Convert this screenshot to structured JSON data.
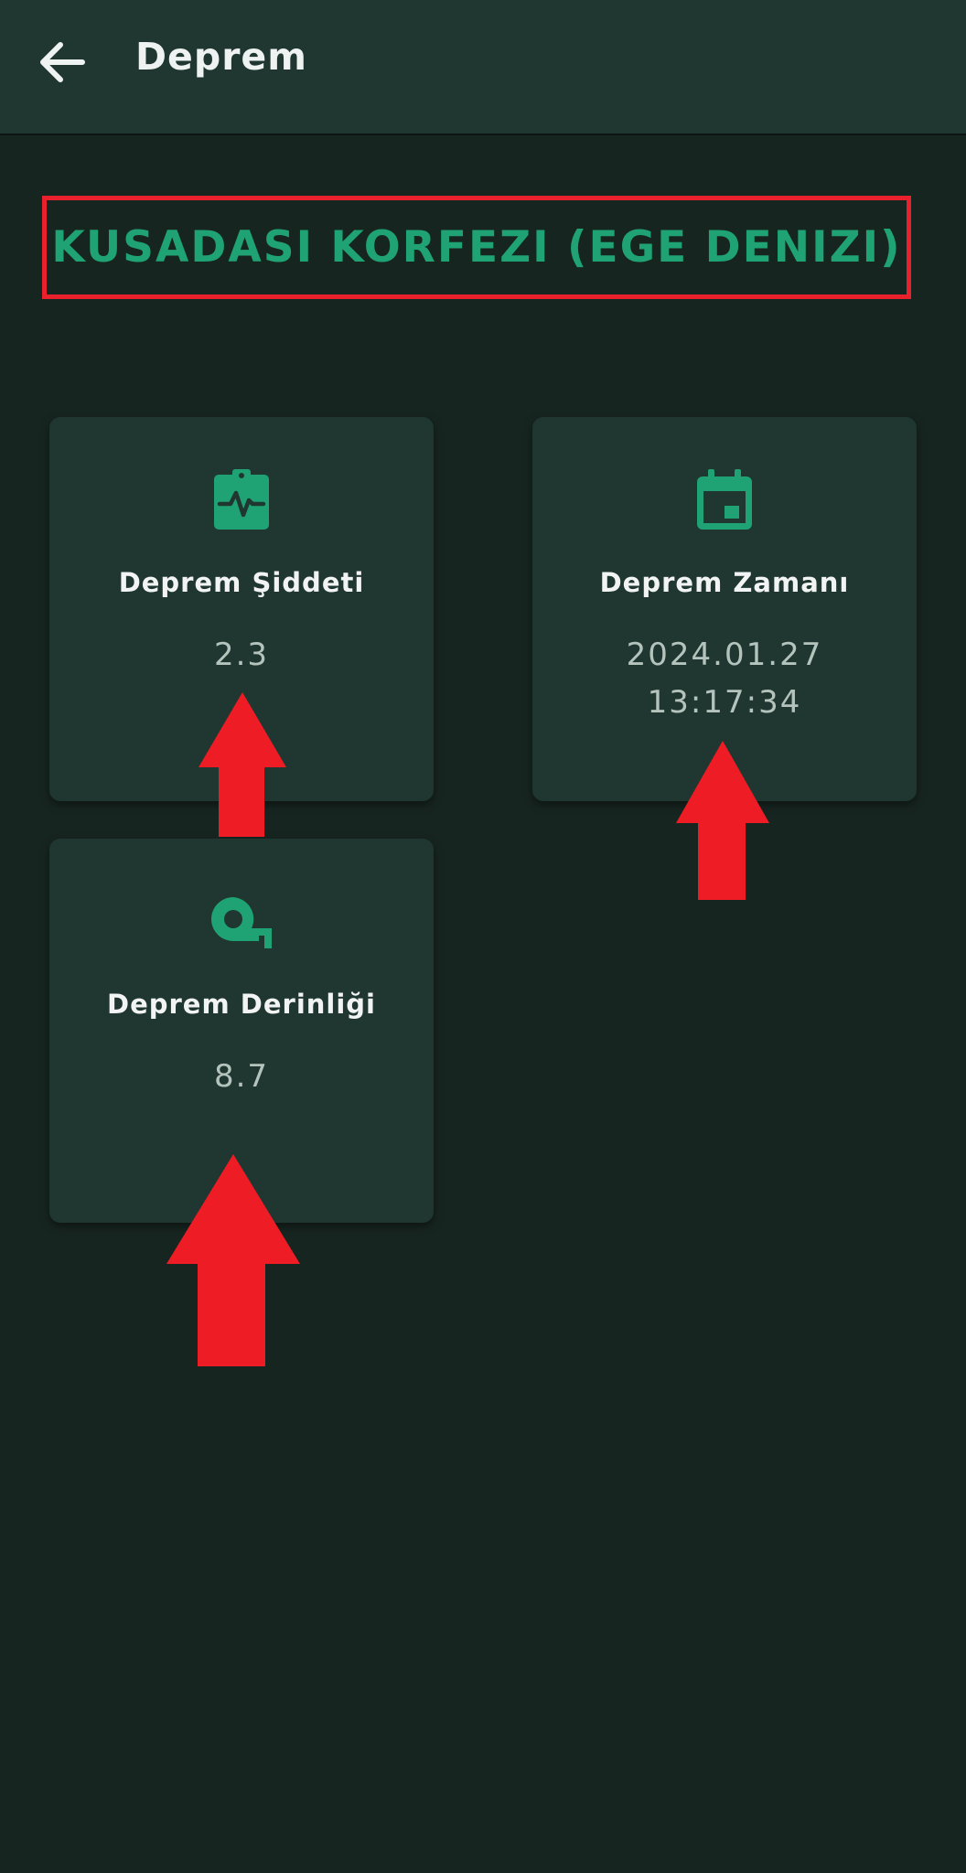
{
  "appbar": {
    "title": "Deprem",
    "back_icon": "arrow-left-icon"
  },
  "location": {
    "title": "KUSADASI KORFEZI (EGE DENIZI)",
    "highlight_color": "#e8212c"
  },
  "cards": {
    "magnitude": {
      "icon": "clipboard-pulse-icon",
      "label": "Deprem Şiddeti",
      "value": "2.3"
    },
    "time": {
      "icon": "calendar-icon",
      "label": "Deprem Zamanı",
      "date": "2024.01.27",
      "clock": "13:17:34"
    },
    "depth": {
      "icon": "tape-measure-icon",
      "label": "Deprem Derinliği",
      "value": "8.7"
    }
  },
  "colors": {
    "background": "#172520",
    "surface": "#1f3730",
    "accent": "#1fa374",
    "annotation": "#e8212c"
  }
}
